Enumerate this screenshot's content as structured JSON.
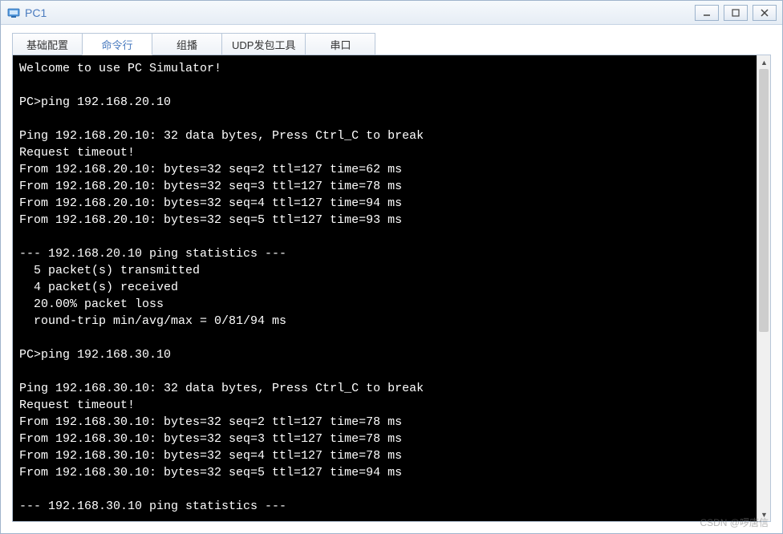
{
  "window": {
    "title": "PC1"
  },
  "tabs": {
    "items": [
      {
        "label": "基础配置"
      },
      {
        "label": "命令行"
      },
      {
        "label": "组播"
      },
      {
        "label": "UDP发包工具"
      },
      {
        "label": "串口"
      }
    ],
    "activeIndex": 1
  },
  "terminal": {
    "lines": [
      "Welcome to use PC Simulator!",
      "",
      "PC>ping 192.168.20.10",
      "",
      "Ping 192.168.20.10: 32 data bytes, Press Ctrl_C to break",
      "Request timeout!",
      "From 192.168.20.10: bytes=32 seq=2 ttl=127 time=62 ms",
      "From 192.168.20.10: bytes=32 seq=3 ttl=127 time=78 ms",
      "From 192.168.20.10: bytes=32 seq=4 ttl=127 time=94 ms",
      "From 192.168.20.10: bytes=32 seq=5 ttl=127 time=93 ms",
      "",
      "--- 192.168.20.10 ping statistics ---",
      "  5 packet(s) transmitted",
      "  4 packet(s) received",
      "  20.00% packet loss",
      "  round-trip min/avg/max = 0/81/94 ms",
      "",
      "PC>ping 192.168.30.10",
      "",
      "Ping 192.168.30.10: 32 data bytes, Press Ctrl_C to break",
      "Request timeout!",
      "From 192.168.30.10: bytes=32 seq=2 ttl=127 time=78 ms",
      "From 192.168.30.10: bytes=32 seq=3 ttl=127 time=78 ms",
      "From 192.168.30.10: bytes=32 seq=4 ttl=127 time=78 ms",
      "From 192.168.30.10: bytes=32 seq=5 ttl=127 time=94 ms",
      "",
      "--- 192.168.30.10 ping statistics ---"
    ]
  },
  "watermark": "CSDN @啰唐信"
}
